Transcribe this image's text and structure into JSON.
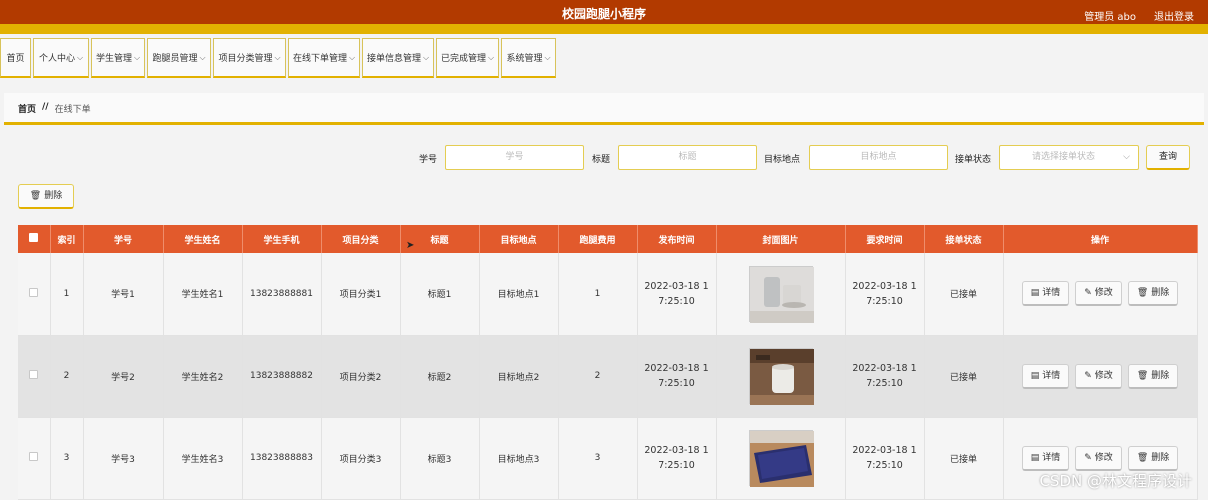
{
  "header": {
    "title": "校园跑腿小程序",
    "user": "管理员 abo",
    "logout": "退出登录"
  },
  "nav": [
    {
      "label": "首页",
      "dropdown": false
    },
    {
      "label": "个人中心",
      "dropdown": true
    },
    {
      "label": "学生管理",
      "dropdown": true
    },
    {
      "label": "跑腿员管理",
      "dropdown": true
    },
    {
      "label": "项目分类管理",
      "dropdown": true
    },
    {
      "label": "在线下单管理",
      "dropdown": true
    },
    {
      "label": "接单信息管理",
      "dropdown": true
    },
    {
      "label": "已完成管理",
      "dropdown": true
    },
    {
      "label": "系统管理",
      "dropdown": true
    }
  ],
  "breadcrumb": {
    "home": "首页",
    "sep": "//",
    "current": "在线下单"
  },
  "search": {
    "label1": "学号",
    "placeholder1": "学号",
    "label2": "标题",
    "placeholder2": "标题",
    "label3": "目标地点",
    "placeholder3": "目标地点",
    "label4": "接单状态",
    "placeholder4": "请选择接单状态",
    "query": "查询"
  },
  "toolbar": {
    "delete": "删除"
  },
  "table": {
    "columns": [
      "",
      "索引",
      "学号",
      "学生姓名",
      "学生手机",
      "项目分类",
      "标题",
      "目标地点",
      "跑腿费用",
      "发布时间",
      "封面图片",
      "要求时间",
      "接单状态",
      "操作"
    ],
    "rows": [
      {
        "index": "1",
        "student_id": "学号1",
        "name": "学生姓名1",
        "phone": "13823888881",
        "category": "项目分类1",
        "title": "标题1",
        "location": "目标地点1",
        "fee": "1",
        "pub_time_1": "2022-03-18 1",
        "pub_time_2": "7:25:10",
        "req_time_1": "2022-03-18 1",
        "req_time_2": "7:25:10",
        "status": "已接单"
      },
      {
        "index": "2",
        "student_id": "学号2",
        "name": "学生姓名2",
        "phone": "13823888882",
        "category": "项目分类2",
        "title": "标题2",
        "location": "目标地点2",
        "fee": "2",
        "pub_time_1": "2022-03-18 1",
        "pub_time_2": "7:25:10",
        "req_time_1": "2022-03-18 1",
        "req_time_2": "7:25:10",
        "status": "已接单"
      },
      {
        "index": "3",
        "student_id": "学号3",
        "name": "学生姓名3",
        "phone": "13823888883",
        "category": "项目分类3",
        "title": "标题3",
        "location": "目标地点3",
        "fee": "3",
        "pub_time_1": "2022-03-18 1",
        "pub_time_2": "7:25:10",
        "req_time_1": "2022-03-18 1",
        "req_time_2": "7:25:10",
        "status": "已接单"
      }
    ],
    "actions": {
      "detail": "详情",
      "edit": "修改",
      "delete": "删除"
    }
  },
  "watermark": "CSDN @林文程序设计",
  "colors": {
    "header": "#b23a00",
    "accent": "#e2b100",
    "table_header": "#e25a2c"
  },
  "icons": {
    "delete": "trash-icon",
    "detail": "document-icon",
    "edit": "pencil-icon",
    "dropdown": "chevron-down-icon"
  }
}
